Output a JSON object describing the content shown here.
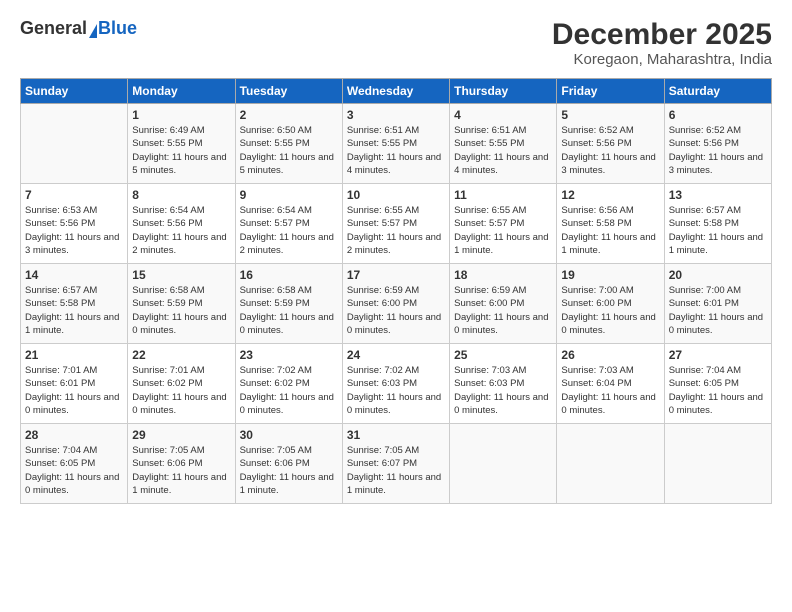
{
  "logo": {
    "general": "General",
    "blue": "Blue"
  },
  "title": "December 2025",
  "location": "Koregaon, Maharashtra, India",
  "days_of_week": [
    "Sunday",
    "Monday",
    "Tuesday",
    "Wednesday",
    "Thursday",
    "Friday",
    "Saturday"
  ],
  "weeks": [
    [
      {
        "day": "",
        "sunrise": "",
        "sunset": "",
        "daylight": ""
      },
      {
        "day": "1",
        "sunrise": "Sunrise: 6:49 AM",
        "sunset": "Sunset: 5:55 PM",
        "daylight": "Daylight: 11 hours and 5 minutes."
      },
      {
        "day": "2",
        "sunrise": "Sunrise: 6:50 AM",
        "sunset": "Sunset: 5:55 PM",
        "daylight": "Daylight: 11 hours and 5 minutes."
      },
      {
        "day": "3",
        "sunrise": "Sunrise: 6:51 AM",
        "sunset": "Sunset: 5:55 PM",
        "daylight": "Daylight: 11 hours and 4 minutes."
      },
      {
        "day": "4",
        "sunrise": "Sunrise: 6:51 AM",
        "sunset": "Sunset: 5:55 PM",
        "daylight": "Daylight: 11 hours and 4 minutes."
      },
      {
        "day": "5",
        "sunrise": "Sunrise: 6:52 AM",
        "sunset": "Sunset: 5:56 PM",
        "daylight": "Daylight: 11 hours and 3 minutes."
      },
      {
        "day": "6",
        "sunrise": "Sunrise: 6:52 AM",
        "sunset": "Sunset: 5:56 PM",
        "daylight": "Daylight: 11 hours and 3 minutes."
      }
    ],
    [
      {
        "day": "7",
        "sunrise": "Sunrise: 6:53 AM",
        "sunset": "Sunset: 5:56 PM",
        "daylight": "Daylight: 11 hours and 3 minutes."
      },
      {
        "day": "8",
        "sunrise": "Sunrise: 6:54 AM",
        "sunset": "Sunset: 5:56 PM",
        "daylight": "Daylight: 11 hours and 2 minutes."
      },
      {
        "day": "9",
        "sunrise": "Sunrise: 6:54 AM",
        "sunset": "Sunset: 5:57 PM",
        "daylight": "Daylight: 11 hours and 2 minutes."
      },
      {
        "day": "10",
        "sunrise": "Sunrise: 6:55 AM",
        "sunset": "Sunset: 5:57 PM",
        "daylight": "Daylight: 11 hours and 2 minutes."
      },
      {
        "day": "11",
        "sunrise": "Sunrise: 6:55 AM",
        "sunset": "Sunset: 5:57 PM",
        "daylight": "Daylight: 11 hours and 1 minute."
      },
      {
        "day": "12",
        "sunrise": "Sunrise: 6:56 AM",
        "sunset": "Sunset: 5:58 PM",
        "daylight": "Daylight: 11 hours and 1 minute."
      },
      {
        "day": "13",
        "sunrise": "Sunrise: 6:57 AM",
        "sunset": "Sunset: 5:58 PM",
        "daylight": "Daylight: 11 hours and 1 minute."
      }
    ],
    [
      {
        "day": "14",
        "sunrise": "Sunrise: 6:57 AM",
        "sunset": "Sunset: 5:58 PM",
        "daylight": "Daylight: 11 hours and 1 minute."
      },
      {
        "day": "15",
        "sunrise": "Sunrise: 6:58 AM",
        "sunset": "Sunset: 5:59 PM",
        "daylight": "Daylight: 11 hours and 0 minutes."
      },
      {
        "day": "16",
        "sunrise": "Sunrise: 6:58 AM",
        "sunset": "Sunset: 5:59 PM",
        "daylight": "Daylight: 11 hours and 0 minutes."
      },
      {
        "day": "17",
        "sunrise": "Sunrise: 6:59 AM",
        "sunset": "Sunset: 6:00 PM",
        "daylight": "Daylight: 11 hours and 0 minutes."
      },
      {
        "day": "18",
        "sunrise": "Sunrise: 6:59 AM",
        "sunset": "Sunset: 6:00 PM",
        "daylight": "Daylight: 11 hours and 0 minutes."
      },
      {
        "day": "19",
        "sunrise": "Sunrise: 7:00 AM",
        "sunset": "Sunset: 6:00 PM",
        "daylight": "Daylight: 11 hours and 0 minutes."
      },
      {
        "day": "20",
        "sunrise": "Sunrise: 7:00 AM",
        "sunset": "Sunset: 6:01 PM",
        "daylight": "Daylight: 11 hours and 0 minutes."
      }
    ],
    [
      {
        "day": "21",
        "sunrise": "Sunrise: 7:01 AM",
        "sunset": "Sunset: 6:01 PM",
        "daylight": "Daylight: 11 hours and 0 minutes."
      },
      {
        "day": "22",
        "sunrise": "Sunrise: 7:01 AM",
        "sunset": "Sunset: 6:02 PM",
        "daylight": "Daylight: 11 hours and 0 minutes."
      },
      {
        "day": "23",
        "sunrise": "Sunrise: 7:02 AM",
        "sunset": "Sunset: 6:02 PM",
        "daylight": "Daylight: 11 hours and 0 minutes."
      },
      {
        "day": "24",
        "sunrise": "Sunrise: 7:02 AM",
        "sunset": "Sunset: 6:03 PM",
        "daylight": "Daylight: 11 hours and 0 minutes."
      },
      {
        "day": "25",
        "sunrise": "Sunrise: 7:03 AM",
        "sunset": "Sunset: 6:03 PM",
        "daylight": "Daylight: 11 hours and 0 minutes."
      },
      {
        "day": "26",
        "sunrise": "Sunrise: 7:03 AM",
        "sunset": "Sunset: 6:04 PM",
        "daylight": "Daylight: 11 hours and 0 minutes."
      },
      {
        "day": "27",
        "sunrise": "Sunrise: 7:04 AM",
        "sunset": "Sunset: 6:05 PM",
        "daylight": "Daylight: 11 hours and 0 minutes."
      }
    ],
    [
      {
        "day": "28",
        "sunrise": "Sunrise: 7:04 AM",
        "sunset": "Sunset: 6:05 PM",
        "daylight": "Daylight: 11 hours and 0 minutes."
      },
      {
        "day": "29",
        "sunrise": "Sunrise: 7:05 AM",
        "sunset": "Sunset: 6:06 PM",
        "daylight": "Daylight: 11 hours and 1 minute."
      },
      {
        "day": "30",
        "sunrise": "Sunrise: 7:05 AM",
        "sunset": "Sunset: 6:06 PM",
        "daylight": "Daylight: 11 hours and 1 minute."
      },
      {
        "day": "31",
        "sunrise": "Sunrise: 7:05 AM",
        "sunset": "Sunset: 6:07 PM",
        "daylight": "Daylight: 11 hours and 1 minute."
      },
      {
        "day": "",
        "sunrise": "",
        "sunset": "",
        "daylight": ""
      },
      {
        "day": "",
        "sunrise": "",
        "sunset": "",
        "daylight": ""
      },
      {
        "day": "",
        "sunrise": "",
        "sunset": "",
        "daylight": ""
      }
    ]
  ]
}
